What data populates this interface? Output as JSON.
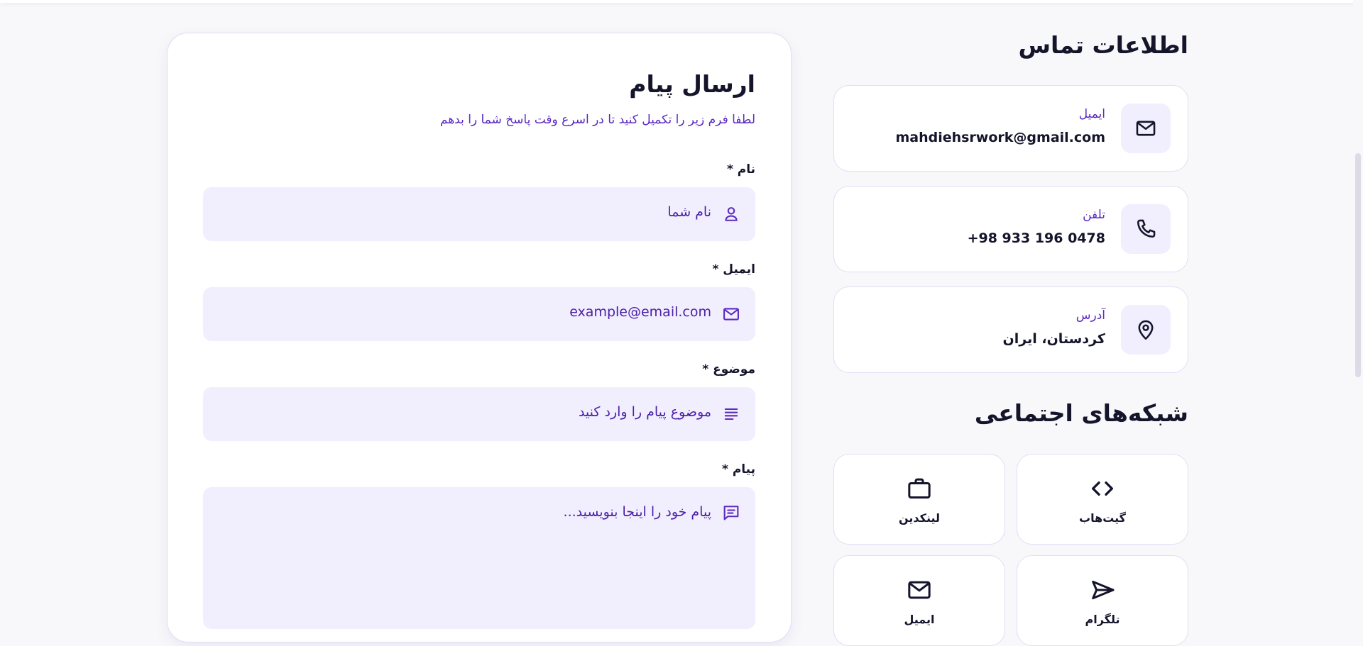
{
  "form": {
    "title": "ارسال پیام",
    "subtitle": "لطفا فرم زیر را تکمیل کنید تا در اسرع وقت پاسخ شما را بدهم",
    "fields": [
      {
        "label": "نام *",
        "placeholder": "نام شما",
        "icon": "user-icon"
      },
      {
        "label": "ایمیل *",
        "placeholder": "example@email.com",
        "icon": "mail-icon"
      },
      {
        "label": "موضوع *",
        "placeholder": "موضوع پیام را وارد کنید",
        "icon": "subject-icon"
      },
      {
        "label": "پیام *",
        "placeholder": "پیام خود را اینجا بنویسید...",
        "icon": "message-icon"
      }
    ]
  },
  "contact": {
    "title": "اطلاعات تماس",
    "items": [
      {
        "label": "ایمیل",
        "value": "mahdiehsrwork@gmail.com",
        "icon": "mail-icon"
      },
      {
        "label": "تلفن",
        "value": "+98 933 196 0478",
        "icon": "phone-icon"
      },
      {
        "label": "آدرس",
        "value": "کردستان، ایران",
        "icon": "location-pin-icon"
      }
    ]
  },
  "social": {
    "title": "شبکه‌های اجتماعی",
    "items": [
      {
        "label": "گیت‌هاب",
        "icon": "code-icon"
      },
      {
        "label": "لینکدین",
        "icon": "briefcase-icon"
      },
      {
        "label": "تلگرام",
        "icon": "send-icon"
      },
      {
        "label": "ایمیل",
        "icon": "mail-icon"
      }
    ]
  },
  "colors": {
    "accent": "#5b2bc0",
    "field_background": "#f1eefe",
    "card_border": "#e2ddf7",
    "page_background": "#f8f8fa"
  }
}
